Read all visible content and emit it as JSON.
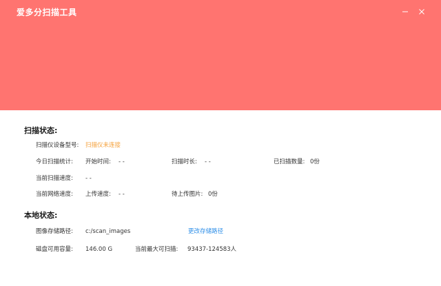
{
  "app": {
    "title": "爱多分扫描工具",
    "header_color": "#ff7470"
  },
  "window_controls": {
    "minimize_icon": "minimize-icon",
    "close_icon": "close-icon"
  },
  "scan_status": {
    "title": "扫描状态:",
    "device_model_label": "扫描仪设备型号:",
    "device_model_value": "扫描仪未连接",
    "today_stats_label": "今日扫描统计:",
    "start_time_label": "开始时间:",
    "start_time_value": "- -",
    "duration_label": "扫描时长:",
    "duration_value": "- -",
    "scanned_count_label": "已扫描数量:",
    "scanned_count_value": "0份",
    "scan_speed_label": "当前扫描速度:",
    "scan_speed_value": "- -",
    "network_speed_label": "当前网络速度:",
    "upload_speed_label": "上传速度:",
    "upload_speed_value": "- -",
    "pending_upload_label": "待上传图片:",
    "pending_upload_value": "0份"
  },
  "local_status": {
    "title": "本地状态:",
    "storage_path_label": "图像存储路径:",
    "storage_path_value": "c:/scan_images",
    "change_path_link": "更改存储路径",
    "disk_space_label": "磁盘可用容量:",
    "disk_space_value": "146.00 G",
    "max_scan_label": "当前最大可扫描:",
    "max_scan_value": "93437-124583人"
  },
  "colors": {
    "warning": "#f5a03a",
    "link": "#2f8fe8"
  }
}
